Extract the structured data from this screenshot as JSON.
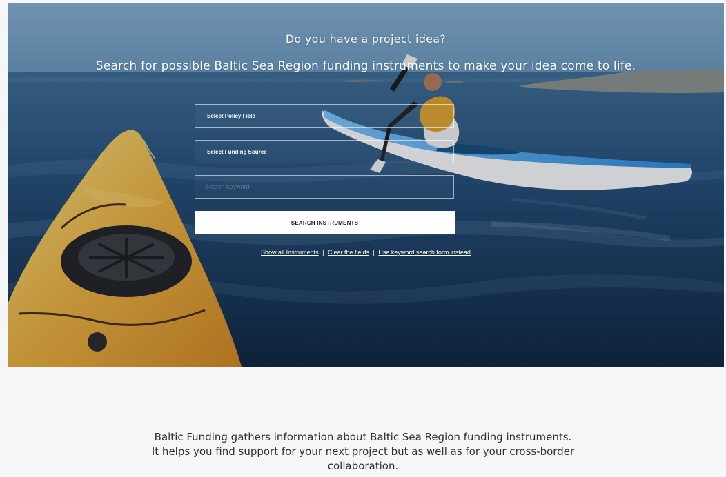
{
  "hero": {
    "question": "Do you have a project idea?",
    "subtitle": "Search for possible Baltic Sea Region funding instruments to make your idea come to life."
  },
  "search": {
    "policy_field_label": "Select Policy Field",
    "funding_source_label": "Select Funding Source",
    "keyword_value": "",
    "keyword_placeholder": "Search keyword",
    "button_label": "SEARCH INSTRUMENTS"
  },
  "links": {
    "show_all": "Show all Instruments",
    "clear": "Clear the fields",
    "keyword_form": "Use keyword search form instead",
    "separator": "|"
  },
  "about": {
    "line1": "Baltic Funding gathers information about Baltic Sea Region funding instruments.",
    "line2": "It helps you find support for your next project but as well as for your cross-border",
    "line3": "collaboration."
  }
}
